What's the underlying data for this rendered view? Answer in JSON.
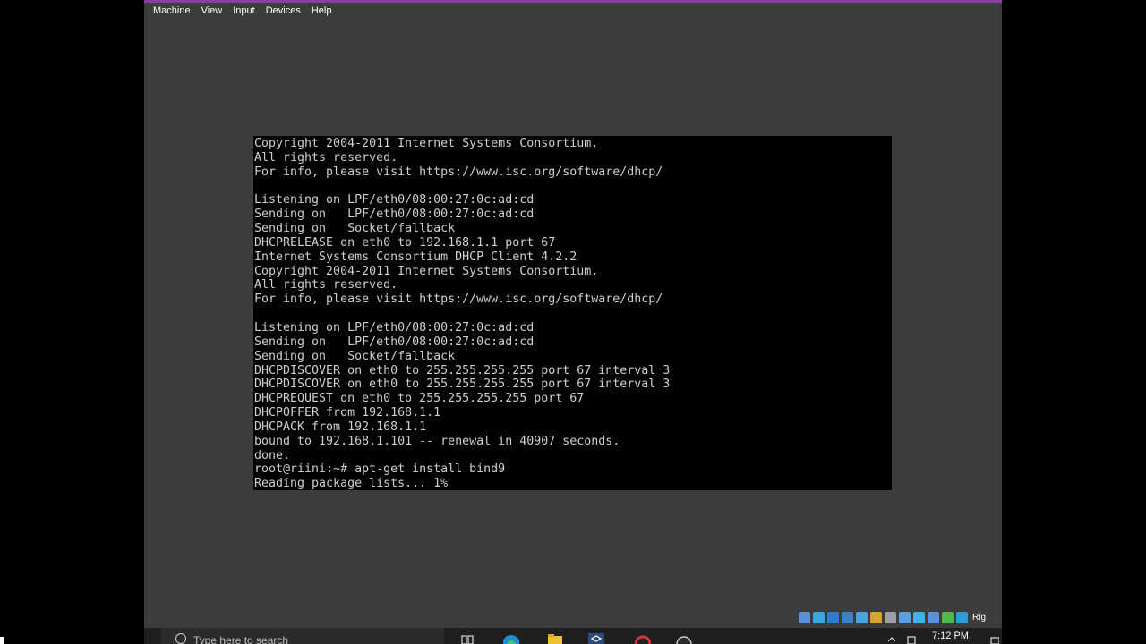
{
  "menubar": {
    "items": [
      "Machine",
      "View",
      "Input",
      "Devices",
      "Help"
    ]
  },
  "terminal": {
    "lines": [
      "Copyright 2004-2011 Internet Systems Consortium.",
      "All rights reserved.",
      "For info, please visit https://www.isc.org/software/dhcp/",
      "",
      "Listening on LPF/eth0/08:00:27:0c:ad:cd",
      "Sending on   LPF/eth0/08:00:27:0c:ad:cd",
      "Sending on   Socket/fallback",
      "DHCPRELEASE on eth0 to 192.168.1.1 port 67",
      "Internet Systems Consortium DHCP Client 4.2.2",
      "Copyright 2004-2011 Internet Systems Consortium.",
      "All rights reserved.",
      "For info, please visit https://www.isc.org/software/dhcp/",
      "",
      "Listening on LPF/eth0/08:00:27:0c:ad:cd",
      "Sending on   LPF/eth0/08:00:27:0c:ad:cd",
      "Sending on   Socket/fallback",
      "DHCPDISCOVER on eth0 to 255.255.255.255 port 67 interval 3",
      "DHCPDISCOVER on eth0 to 255.255.255.255 port 67 interval 3",
      "DHCPREQUEST on eth0 to 255.255.255.255 port 67",
      "DHCPOFFER from 192.168.1.1",
      "DHCPACK from 192.168.1.1",
      "bound to 192.168.1.101 -- renewal in 40907 seconds.",
      "done.",
      "root@riini:~# apt-get install bind9",
      "Reading package lists... 1%"
    ]
  },
  "statusbar": {
    "host_key": "Rig",
    "icons": [
      "harddisk-icon",
      "optical-drive-icon",
      "audio-icon",
      "network-icon",
      "usb-icon",
      "shared-folder-icon",
      "display-icon",
      "video-capture-icon",
      "mouse-integration-icon",
      "cpu-icon",
      "arrow-icon",
      "keyboard-icon"
    ],
    "icon_colors": [
      "#5b8fd6",
      "#3aa6e0",
      "#2f7dd1",
      "#3b82c4",
      "#4aa3df",
      "#d8a233",
      "#9aa0a6",
      "#5aa0e0",
      "#3db3e6",
      "#5a8fdb",
      "#4fb84a",
      "#2e9bd6"
    ]
  },
  "taskbar": {
    "search_placeholder": "Type here to search",
    "clock": "7:12 PM",
    "apps": [
      "task-view-icon",
      "edge-icon",
      "file-explorer-icon",
      "virtualbox-icon",
      "opera-icon",
      "obs-icon"
    ]
  }
}
